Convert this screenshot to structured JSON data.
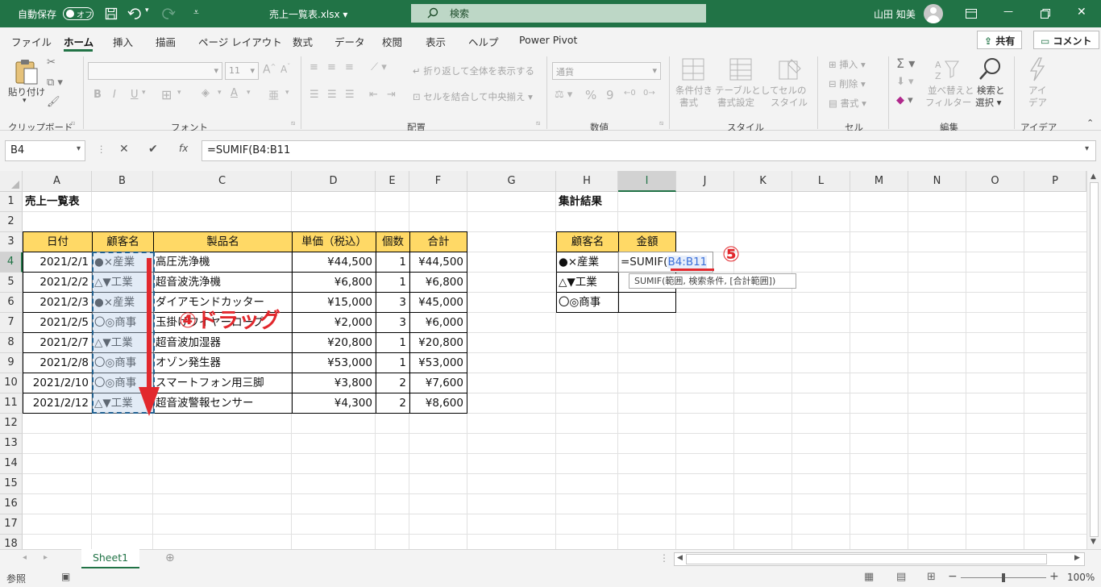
{
  "titlebar": {
    "autosave_label": "自動保存",
    "autosave_state": "オフ",
    "filename": "売上一覧表.xlsx ▾",
    "search_placeholder": "検索",
    "user_name": "山田 知美"
  },
  "menu": {
    "tabs": [
      "ファイル",
      "ホーム",
      "挿入",
      "描画",
      "ページ レイアウト",
      "数式",
      "データ",
      "校閲",
      "表示",
      "ヘルプ",
      "Power Pivot"
    ],
    "active_tab": "ホーム",
    "share": "共有",
    "comment": "コメント"
  },
  "ribbon": {
    "clipboard": {
      "paste": "貼り付け",
      "group": "クリップボード"
    },
    "font": {
      "size": "11",
      "bold": "B",
      "italic": "I",
      "underline": "U",
      "group": "フォント"
    },
    "alignment": {
      "wrap": "折り返して全体を表示する",
      "merge": "セルを結合して中央揃え",
      "group": "配置"
    },
    "number": {
      "format": "通貨",
      "group": "数値"
    },
    "styles": {
      "conditional": [
        "条件付き",
        "書式"
      ],
      "table": [
        "テーブルとして",
        "書式設定"
      ],
      "cellstyle": [
        "セルの",
        "スタイル"
      ],
      "group": "スタイル"
    },
    "cells": {
      "insert": "挿入",
      "delete": "削除",
      "format": "書式",
      "group": "セル"
    },
    "editing": {
      "sort": [
        "並べ替えと",
        "フィルター"
      ],
      "find": [
        "検索と",
        "選択"
      ],
      "group": "編集"
    },
    "ideas": {
      "label": [
        "アイ",
        "デア"
      ],
      "group": "アイデア"
    }
  },
  "formula_bar": {
    "name_box": "B4",
    "formula": "=SUMIF(B4:B11"
  },
  "columns": [
    "A",
    "B",
    "C",
    "D",
    "E",
    "F",
    "G",
    "H",
    "I",
    "J",
    "K",
    "L",
    "M",
    "N",
    "O",
    "P"
  ],
  "rows": [
    "1",
    "2",
    "3",
    "4",
    "5",
    "6",
    "7",
    "8",
    "9",
    "10",
    "11",
    "12",
    "13",
    "14",
    "15",
    "16",
    "17",
    "18"
  ],
  "table": {
    "title": "売上一覧表",
    "headers": [
      "日付",
      "顧客名",
      "製品名",
      "単価（税込）",
      "個数",
      "合計"
    ],
    "rows": [
      [
        "2021/2/1",
        "●×産業",
        "高圧洗浄機",
        "¥44,500",
        "1",
        "¥44,500"
      ],
      [
        "2021/2/2",
        "△▼工業",
        "超音波洗浄機",
        "¥6,800",
        "1",
        "¥6,800"
      ],
      [
        "2021/2/3",
        "●×産業",
        "ダイアモンドカッター",
        "¥15,000",
        "3",
        "¥45,000"
      ],
      [
        "2021/2/5",
        "〇◎商事",
        "玉掛けワイヤーロープ",
        "¥2,000",
        "3",
        "¥6,000"
      ],
      [
        "2021/2/7",
        "△▼工業",
        "超音波加湿器",
        "¥20,800",
        "1",
        "¥20,800"
      ],
      [
        "2021/2/8",
        "〇◎商事",
        "オゾン発生器",
        "¥53,000",
        "1",
        "¥53,000"
      ],
      [
        "2021/2/10",
        "〇◎商事",
        "スマートフォン用三脚",
        "¥3,800",
        "2",
        "¥7,600"
      ],
      [
        "2021/2/12",
        "△▼工業",
        "超音波警報センサー",
        "¥4,300",
        "2",
        "¥8,600"
      ]
    ]
  },
  "summary": {
    "title": "集計結果",
    "headers": [
      "顧客名",
      "金額"
    ],
    "customers": [
      "●×産業",
      "△▼工業",
      "〇◎商事"
    ],
    "formula_prefix": "=SUMIF(",
    "formula_range": "B4:B11",
    "tooltip": "SUMIF(範囲, 検索条件, [合計範囲])"
  },
  "annotations": {
    "drag": "④ドラッグ",
    "step": "⑤",
    "accent_color": "#e2282d"
  },
  "sheets": [
    "Sheet1"
  ],
  "status": {
    "mode": "参照",
    "zoom": "100%"
  },
  "colors": {
    "excel_green": "#217346",
    "header_fill": "#ffd966"
  }
}
